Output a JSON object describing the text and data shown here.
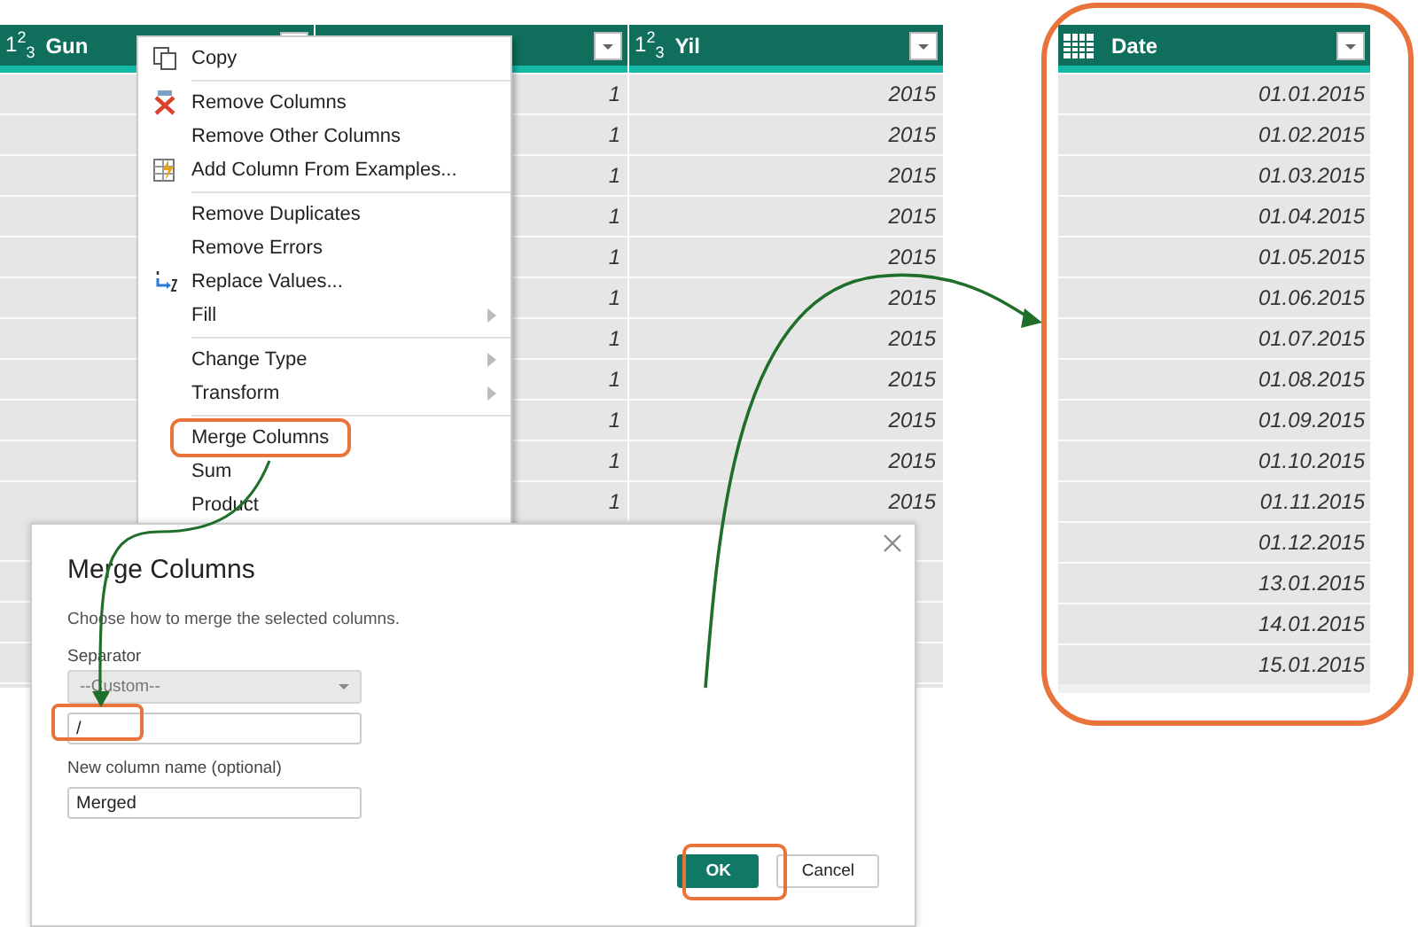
{
  "table": {
    "columns": [
      {
        "kind": "number",
        "type_label": "1$^{2}$$_{3}$",
        "label": "Gun"
      },
      {
        "kind": "covered"
      },
      {
        "kind": "number",
        "type_label": "1$^{2}$$_{3}$",
        "label": "Yil"
      }
    ],
    "rows": [
      {
        "column_2": "1",
        "yil": "2015"
      },
      {
        "column_2": "1",
        "yil": "2015"
      },
      {
        "column_2": "1",
        "yil": "2015"
      },
      {
        "column_2": "1",
        "yil": "2015"
      },
      {
        "column_2": "1",
        "yil": "2015"
      },
      {
        "column_2": "1",
        "yil": "2015"
      },
      {
        "column_2": "1",
        "yil": "2015"
      },
      {
        "column_2": "1",
        "yil": "2015"
      },
      {
        "column_2": "1",
        "yil": "2015"
      },
      {
        "column_2": "1",
        "yil": "2015"
      },
      {
        "column_2": "1",
        "yil": "2015"
      }
    ]
  },
  "context_menu": {
    "items": [
      {
        "label": "Copy",
        "separator_before": false,
        "submenu": false,
        "annotated": false
      },
      {
        "label": "Remove Columns",
        "separator_before": true,
        "submenu": false,
        "annotated": false
      },
      {
        "label": "Remove Other Columns",
        "separator_before": false,
        "submenu": false,
        "annotated": false
      },
      {
        "label": "Add Column From Examples...",
        "separator_before": false,
        "submenu": false,
        "annotated": false
      },
      {
        "label": "Remove Duplicates",
        "separator_before": true,
        "submenu": false,
        "annotated": false
      },
      {
        "label": "Remove Errors",
        "separator_before": false,
        "submenu": false,
        "annotated": false
      },
      {
        "label": "Replace Values...",
        "separator_before": false,
        "submenu": false,
        "annotated": false
      },
      {
        "label": "Fill",
        "separator_before": false,
        "submenu": true,
        "annotated": false
      },
      {
        "label": "Change Type",
        "separator_before": true,
        "submenu": true,
        "annotated": false
      },
      {
        "label": "Transform",
        "separator_before": false,
        "submenu": true,
        "annotated": false
      },
      {
        "label": "Merge Columns",
        "separator_before": true,
        "submenu": false,
        "annotated": true
      },
      {
        "label": "Sum",
        "separator_before": false,
        "submenu": false,
        "annotated": false
      },
      {
        "label": "Product",
        "separator_before": false,
        "submenu": false,
        "annotated": false
      }
    ]
  },
  "dialog": {
    "title": "Merge Columns",
    "description": "Choose how to merge the selected columns.",
    "separator_label": "Separator",
    "separator_select": {
      "value": "--Custom--",
      "disabled": true
    },
    "custom_separator": {
      "value": "/",
      "annotated": true
    },
    "name_label": "New column name (optional)",
    "name_field": {
      "value": "Merged"
    },
    "buttons": [
      {
        "label": "OK",
        "primary": true,
        "annotated": true
      },
      {
        "label": "Cancel",
        "primary": false,
        "annotated": false
      }
    ]
  },
  "result_column": {
    "label": "Date",
    "annotated": true,
    "rows": [
      "01.01.2015",
      "01.02.2015",
      "01.03.2015",
      "01.04.2015",
      "01.05.2015",
      "01.06.2015",
      "01.07.2015",
      "01.08.2015",
      "01.09.2015",
      "01.10.2015",
      "01.11.2015",
      "01.12.2015",
      "13.01.2015",
      "14.01.2015",
      "15.01.2015"
    ]
  }
}
